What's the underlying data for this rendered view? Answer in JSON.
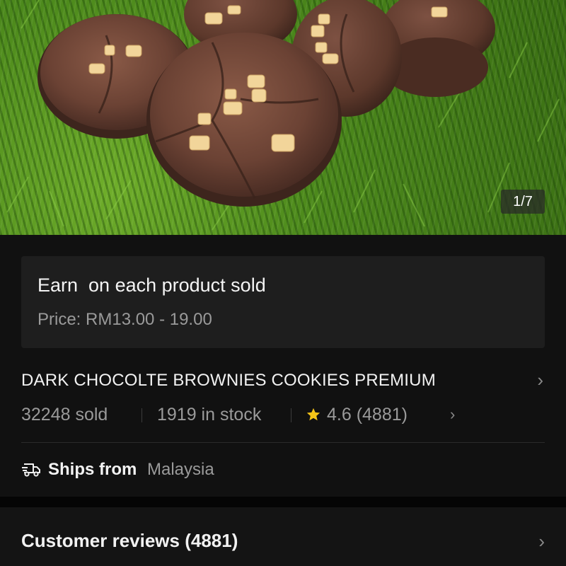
{
  "gallery": {
    "counter": "1/7"
  },
  "affiliate": {
    "earn_text": "Earn  on each product sold",
    "price_text": "Price: RM13.00 - 19.00"
  },
  "product": {
    "title": "DARK CHOCOLTE BROWNIES COOKIES PREMIUM",
    "sold": "32248 sold",
    "stock": "1919 in stock",
    "rating": "4.6 (4881)",
    "star_color": "#f5c518"
  },
  "shipping": {
    "label": "Ships from",
    "origin": "Malaysia"
  },
  "reviews": {
    "title": "Customer reviews (4881)"
  },
  "icons": {
    "counter": "photo-counter",
    "title_chevron": "chevron-right-icon",
    "rating": "star-icon",
    "shipping": "truck-icon",
    "reviews_chevron": "chevron-right-icon"
  }
}
